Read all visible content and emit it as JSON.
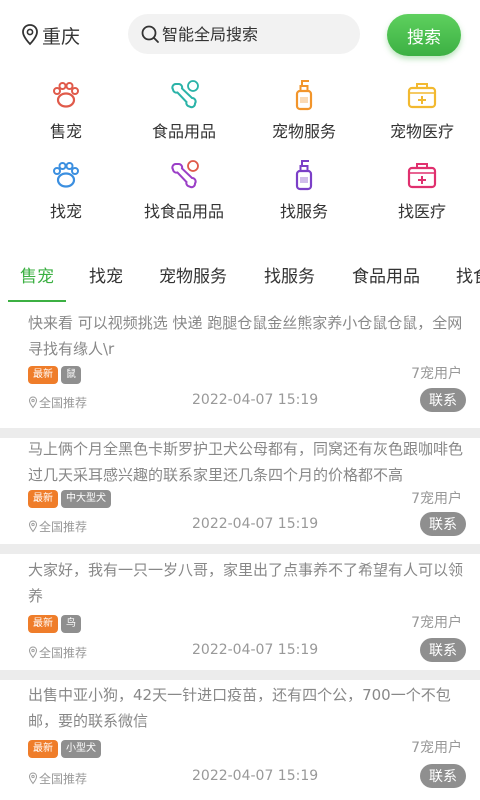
{
  "header": {
    "city": "重庆",
    "search_placeholder": "智能全局搜索",
    "search_button": "搜索"
  },
  "categories": [
    {
      "label": "售宠",
      "icon": "paw-icon",
      "color": "#e05a4a"
    },
    {
      "label": "食品用品",
      "icon": "bone-icon",
      "color": "#2bb3a8"
    },
    {
      "label": "宠物服务",
      "icon": "lotion-bottle-icon",
      "color": "#f2952b"
    },
    {
      "label": "宠物医疗",
      "icon": "medical-kit-icon",
      "color": "#f2b930"
    },
    {
      "label": "找宠",
      "icon": "paw-icon",
      "color": "#3b8fe0"
    },
    {
      "label": "找食品用品",
      "icon": "bone-icon",
      "color": "#9b3fc7"
    },
    {
      "label": "找服务",
      "icon": "lotion-bottle-icon",
      "color": "#7b3fc7"
    },
    {
      "label": "找医疗",
      "icon": "medical-kit-icon",
      "color": "#e0306e"
    }
  ],
  "tabs": [
    "售宠",
    "找宠",
    "宠物服务",
    "找服务",
    "食品用品",
    "找食"
  ],
  "active_tab": "售宠",
  "posts": [
    {
      "text": "快来看 可以视频挑选 快递 跑腿仓鼠金丝熊家养小仓鼠仓鼠，全网寻找有缘人\\r",
      "tag_new": "最新",
      "tag_category": "鼠",
      "user": "7宠用户",
      "region": "全国推荐",
      "time": "2022-04-07 15:19",
      "contact": "联系"
    },
    {
      "text": "马上俩个月全黑色卡斯罗护卫犬公母都有，同窝还有灰色跟咖啡色过几天采耳感兴趣的联系家里还几条四个月的价格都不高",
      "tag_new": "最新",
      "tag_category": "中大型犬",
      "user": "7宠用户",
      "region": "全国推荐",
      "time": "2022-04-07 15:19",
      "contact": "联系"
    },
    {
      "text": "大家好，我有一只一岁八哥，家里出了点事养不了希望有人可以领养",
      "tag_new": "最新",
      "tag_category": "鸟",
      "user": "7宠用户",
      "region": "全国推荐",
      "time": "2022-04-07 15:19",
      "contact": "联系"
    },
    {
      "text": "出售中亚小狗，42天一针进口疫苗，还有四个公，700一个不包邮，要的联系微信",
      "tag_new": "最新",
      "tag_category": "小型犬",
      "user": "7宠用户",
      "region": "全国推荐",
      "time": "2022-04-07 15:19",
      "contact": "联系"
    }
  ]
}
